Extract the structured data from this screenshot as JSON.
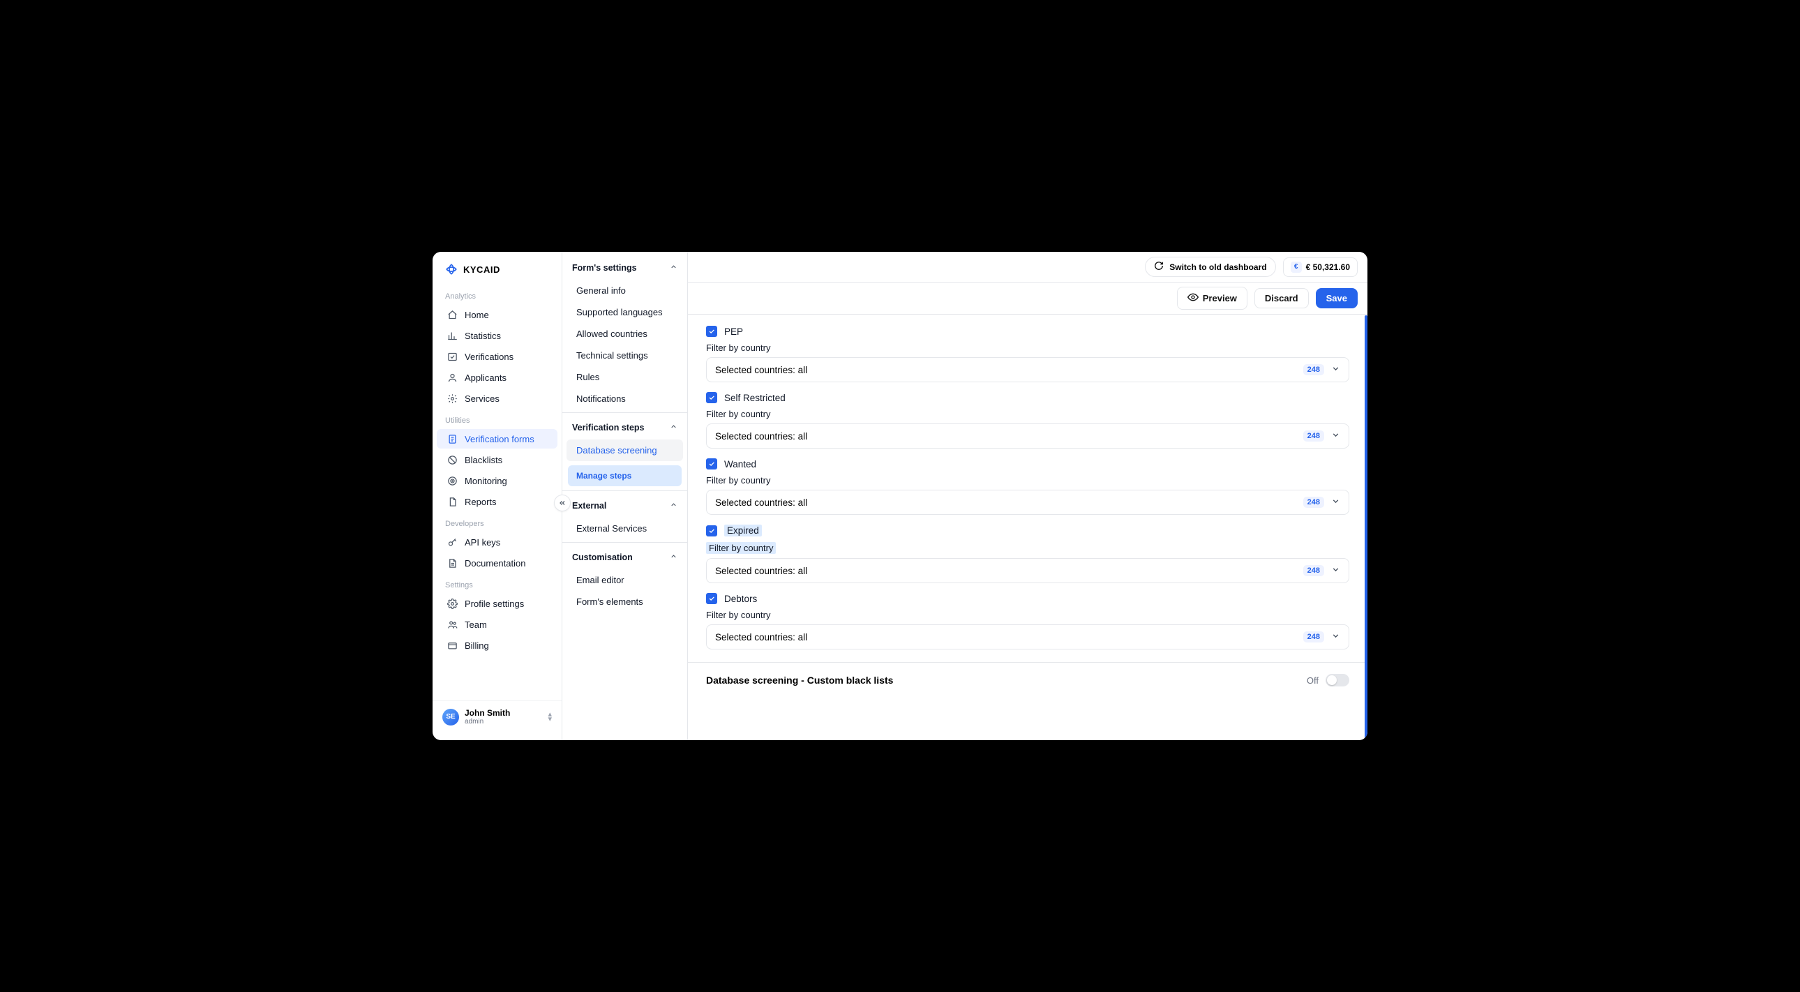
{
  "brand": "KYCAID",
  "sidebar": {
    "sections": [
      {
        "label": "Analytics",
        "items": [
          {
            "id": "home",
            "label": "Home"
          },
          {
            "id": "statistics",
            "label": "Statistics"
          },
          {
            "id": "verifications",
            "label": "Verifications"
          },
          {
            "id": "applicants",
            "label": "Applicants"
          },
          {
            "id": "services",
            "label": "Services"
          }
        ]
      },
      {
        "label": "Utilities",
        "items": [
          {
            "id": "verification-forms",
            "label": "Verification forms",
            "active": true
          },
          {
            "id": "blacklists",
            "label": "Blacklists"
          },
          {
            "id": "monitoring",
            "label": "Monitoring"
          },
          {
            "id": "reports",
            "label": "Reports"
          }
        ]
      },
      {
        "label": "Developers",
        "items": [
          {
            "id": "api-keys",
            "label": "API keys"
          },
          {
            "id": "documentation",
            "label": "Documentation"
          }
        ]
      },
      {
        "label": "Settings",
        "items": [
          {
            "id": "profile-settings",
            "label": "Profile settings"
          },
          {
            "id": "team",
            "label": "Team"
          },
          {
            "id": "billing",
            "label": "Billing"
          }
        ]
      }
    ]
  },
  "user": {
    "initials": "SE",
    "name": "John Smith",
    "role": "admin"
  },
  "topbar": {
    "switch": "Switch to old dashboard",
    "balance": "€ 50,321.60"
  },
  "actions": {
    "preview": "Preview",
    "discard": "Discard",
    "save": "Save"
  },
  "subnav": {
    "groups": [
      {
        "title": "Form's settings",
        "items": [
          "General info",
          "Supported languages",
          "Allowed countries",
          "Technical settings",
          "Rules",
          "Notifications"
        ]
      },
      {
        "title": "Verification steps",
        "items": [
          "Database screening"
        ],
        "current": "Database screening",
        "cta": "Manage steps"
      },
      {
        "title": "External",
        "items": [
          "External Services"
        ]
      },
      {
        "title": "Customisation",
        "items": [
          "Email editor",
          "Form's elements"
        ]
      }
    ]
  },
  "shared": {
    "filter_label": "Filter by country",
    "select_text": "Selected countries: all",
    "count": "248"
  },
  "fields": [
    {
      "id": "pep",
      "label": "PEP"
    },
    {
      "id": "self-restricted",
      "label": "Self Restricted"
    },
    {
      "id": "wanted",
      "label": "Wanted"
    },
    {
      "id": "expired",
      "label": "Expired",
      "highlight": true
    },
    {
      "id": "debtors",
      "label": "Debtors"
    }
  ],
  "custom_blacklist": {
    "title": "Database screening - Custom black lists",
    "state_label": "Off"
  }
}
